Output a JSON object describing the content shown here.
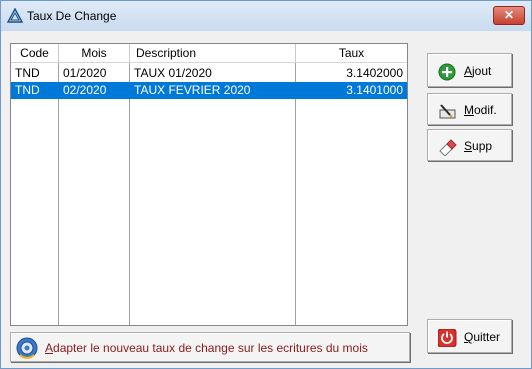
{
  "window": {
    "title": "Taux De Change",
    "close_symbol": "✕"
  },
  "table": {
    "columns": [
      "Code",
      "Mois",
      "Description",
      "Taux"
    ],
    "rows": [
      {
        "code": "TND",
        "mois": "01/2020",
        "description": "TAUX 01/2020",
        "taux": "3.1402000",
        "selected": false
      },
      {
        "code": "TND",
        "mois": "02/2020",
        "description": "TAUX FEVRIER 2020",
        "taux": "3.1401000",
        "selected": true
      }
    ]
  },
  "buttons": {
    "ajout": {
      "label": "Ajout",
      "mnemonic": "A",
      "rest": "jout",
      "icon": "add-circle-icon"
    },
    "modif": {
      "label": "Modif.",
      "mnemonic": "M",
      "rest": "odif.",
      "icon": "edit-pencil-icon"
    },
    "supp": {
      "label": "Supp",
      "mnemonic": "S",
      "rest": "upp",
      "icon": "eraser-icon"
    },
    "quitter": {
      "label": "Quitter",
      "mnemonic": "Q",
      "rest": "uitter",
      "icon": "power-icon"
    }
  },
  "status": {
    "mnemonic": "A",
    "rest": "dapter le nouveau taux de change sur les ecritures du mois",
    "icon": "gear-sync-icon"
  },
  "colors": {
    "selection": "#0078d7",
    "status_text": "#8b1a1a",
    "close_button": "#c7412e"
  }
}
